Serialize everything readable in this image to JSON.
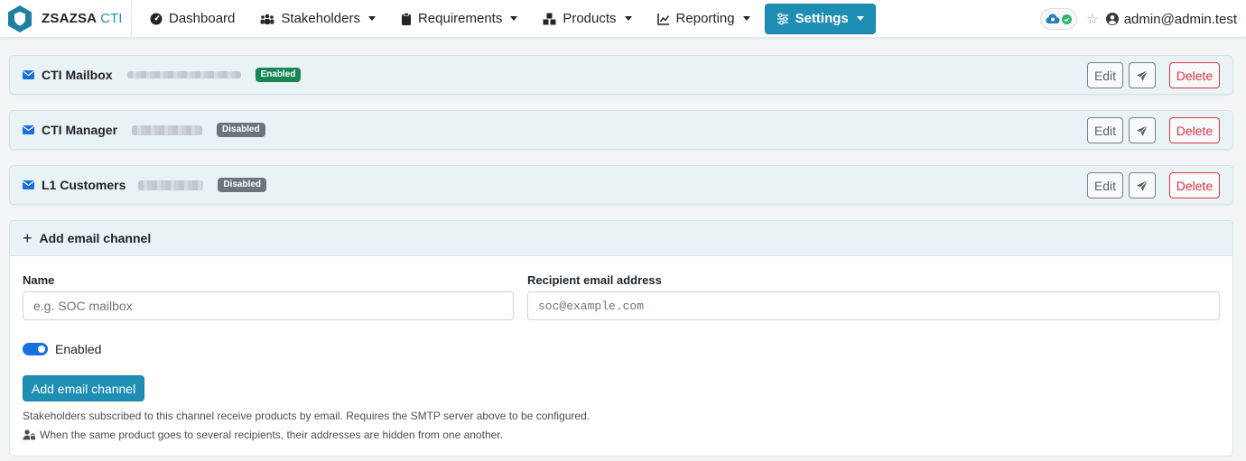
{
  "navbar": {
    "brand": "ZSAZSA",
    "brand_suffix": "CTI",
    "items": [
      {
        "label": "Dashboard",
        "icon": "dashboard-icon",
        "dropdown": false
      },
      {
        "label": "Stakeholders",
        "icon": "users-icon",
        "dropdown": true
      },
      {
        "label": "Requirements",
        "icon": "clipboard-icon",
        "dropdown": true
      },
      {
        "label": "Products",
        "icon": "boxes-icon",
        "dropdown": true
      },
      {
        "label": "Reporting",
        "icon": "chart-line-icon",
        "dropdown": true
      },
      {
        "label": "Settings",
        "icon": "sliders-icon",
        "dropdown": true,
        "active": true
      }
    ],
    "user": "admin@admin.test"
  },
  "channels": [
    {
      "name": "CTI Mailbox",
      "status": "Enabled"
    },
    {
      "name": "CTI Manager",
      "status": "Disabled"
    },
    {
      "name": "L1 Customers",
      "status": "Disabled"
    }
  ],
  "actions": {
    "edit": "Edit",
    "delete": "Delete"
  },
  "add_form": {
    "header": "Add email channel",
    "name_label": "Name",
    "name_placeholder": "e.g. SOC mailbox",
    "email_label": "Recipient email address",
    "email_placeholder": "soc@example.com",
    "enabled_label": "Enabled",
    "enabled": true,
    "submit_label": "Add email channel",
    "hint_1": "Stakeholders subscribed to this channel receive products by email. Requires the SMTP server above to be configured.",
    "hint_2": "When the same product goes to several recipients, their addresses are hidden from one another."
  },
  "colors": {
    "accent": "#1e8fb3",
    "enabled": "#198754",
    "disabled": "#6c757d",
    "danger": "#dc3545"
  }
}
